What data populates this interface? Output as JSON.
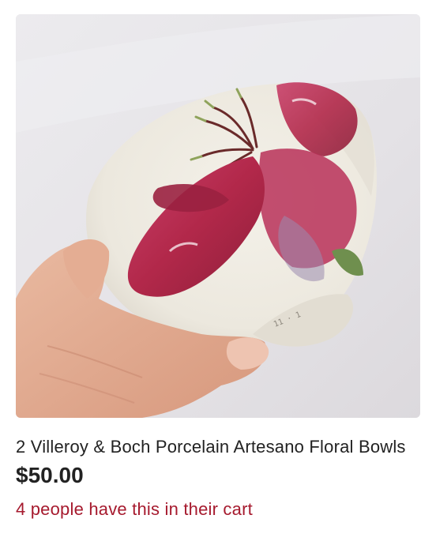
{
  "listing": {
    "image_alt_icon": "product-photo",
    "title": "2 Villeroy & Boch Porcelain Artesano Floral Bowls",
    "price": "$50.00",
    "cart_note": "4 people have this in their cart"
  },
  "colors": {
    "price_text": "#222222",
    "cart_note_text": "#a61a2e",
    "background": "#ffffff"
  }
}
